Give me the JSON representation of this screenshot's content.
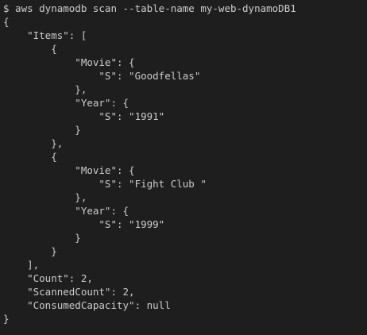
{
  "terminal": {
    "lines": [
      "$ aws dynamodb scan --table-name my-web-dynamoDB1",
      "{",
      "    \"Items\": [",
      "        {",
      "            \"Movie\": {",
      "                \"S\": \"Goodfellas\"",
      "            },",
      "            \"Year\": {",
      "                \"S\": \"1991\"",
      "            }",
      "        },",
      "        {",
      "            \"Movie\": {",
      "                \"S\": \"Fight Club \"",
      "            },",
      "            \"Year\": {",
      "                \"S\": \"1999\"",
      "            }",
      "        }",
      "    ],",
      "    \"Count\": 2,",
      "    \"ScannedCount\": 2,",
      "    \"ConsumedCapacity\": null",
      "}"
    ]
  }
}
